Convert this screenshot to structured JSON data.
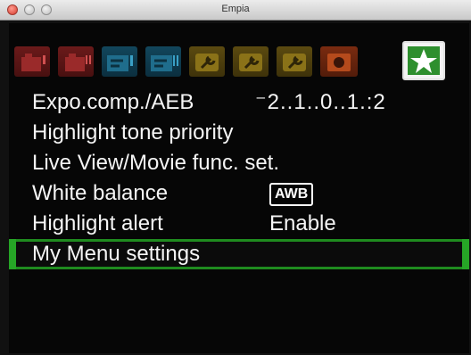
{
  "window": {
    "title": "Empia"
  },
  "tabs": [
    {
      "name": "shooting-1",
      "color": "#6b1a1a",
      "icon": "camera-tab-icon"
    },
    {
      "name": "shooting-2",
      "color": "#6b1a1a",
      "icon": "camera-tab-icon"
    },
    {
      "name": "shooting-3",
      "color": "#12465c",
      "icon": "setup-tab-icon"
    },
    {
      "name": "shooting-4",
      "color": "#12465c",
      "icon": "setup-tab-icon"
    },
    {
      "name": "setup-1",
      "color": "#5b4a10",
      "icon": "wrench-tab-icon"
    },
    {
      "name": "setup-2",
      "color": "#5b4a10",
      "icon": "wrench-tab-icon"
    },
    {
      "name": "setup-3",
      "color": "#5b4a10",
      "icon": "wrench-tab-icon"
    },
    {
      "name": "playback",
      "color": "#7a2b10",
      "icon": "playback-tab-icon"
    },
    {
      "name": "my-menu",
      "color": "#f3f3f3",
      "icon": "star-icon",
      "active": true
    }
  ],
  "menu": {
    "items": [
      {
        "label": "Expo.comp./AEB",
        "value": "⁻2..1..0..1.:2"
      },
      {
        "label": "Highlight tone priority",
        "value": ""
      },
      {
        "label": "Live View/Movie func. set.",
        "value": ""
      },
      {
        "label": "White balance",
        "value": "AWB"
      },
      {
        "label": "Highlight alert",
        "value": "Enable"
      },
      {
        "label": "My Menu settings",
        "value": ""
      }
    ],
    "selected_index": 5
  },
  "colors": {
    "selection": "#26a526",
    "background": "#060606",
    "text": "#f5f5f5"
  }
}
